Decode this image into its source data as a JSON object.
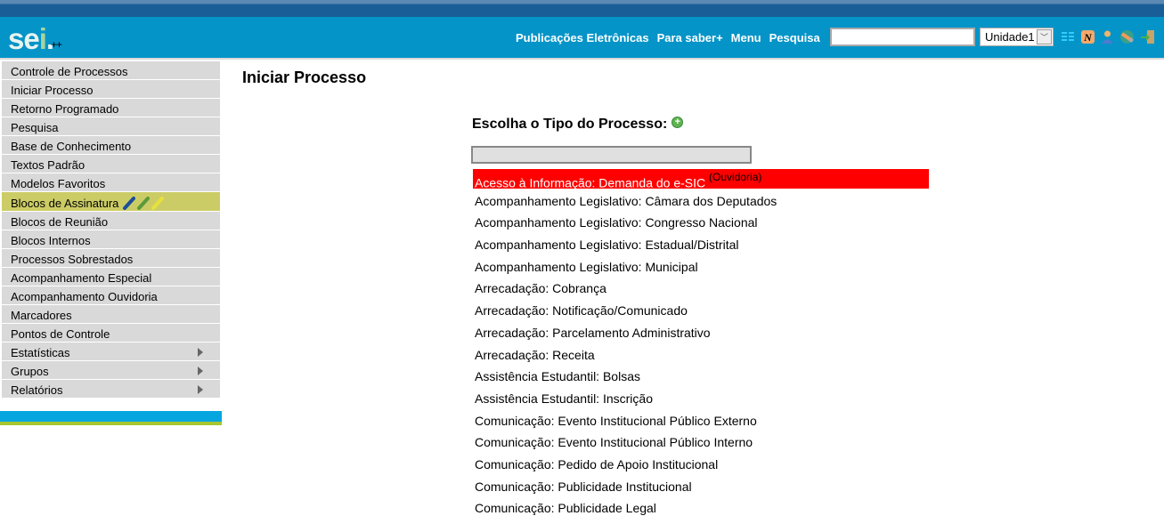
{
  "header": {
    "logo": "sei",
    "logo_suffix": "++",
    "nav": [
      "Publicações Eletrônicas",
      "Para saber+",
      "Menu",
      "Pesquisa"
    ],
    "search_value": "",
    "unit": "Unidade1",
    "icons": [
      "list-icon",
      "notification-icon",
      "user-icon",
      "tools-icon",
      "exit-icon"
    ]
  },
  "sidebar": {
    "items": [
      {
        "label": "Controle de Processos"
      },
      {
        "label": "Iniciar Processo"
      },
      {
        "label": "Retorno Programado"
      },
      {
        "label": "Pesquisa"
      },
      {
        "label": "Base de Conhecimento"
      },
      {
        "label": "Textos Padrão"
      },
      {
        "label": "Modelos Favoritos"
      },
      {
        "label": "Blocos de Assinatura",
        "highlight": true
      },
      {
        "label": "Blocos de Reunião"
      },
      {
        "label": "Blocos Internos"
      },
      {
        "label": "Processos Sobrestados"
      },
      {
        "label": "Acompanhamento Especial"
      },
      {
        "label": "Acompanhamento Ouvidoria"
      },
      {
        "label": "Marcadores"
      },
      {
        "label": "Pontos de Controle"
      },
      {
        "label": "Estatísticas",
        "submenu": true
      },
      {
        "label": "Grupos",
        "submenu": true
      },
      {
        "label": "Relatórios",
        "submenu": true
      }
    ]
  },
  "main": {
    "title": "Iniciar Processo",
    "choose_label": "Escolha o Tipo do Processo:",
    "filter_value": "",
    "types": [
      {
        "label": "Acesso à Informação: Demanda do e-SIC",
        "tag": "(Ouvidoria)",
        "selected": true
      },
      {
        "label": "Acompanhamento Legislativo: Câmara dos Deputados"
      },
      {
        "label": "Acompanhamento Legislativo: Congresso Nacional"
      },
      {
        "label": "Acompanhamento Legislativo: Estadual/Distrital"
      },
      {
        "label": "Acompanhamento Legislativo: Municipal"
      },
      {
        "label": "Arrecadação: Cobrança"
      },
      {
        "label": "Arrecadação: Notificação/Comunicado"
      },
      {
        "label": "Arrecadação: Parcelamento Administrativo"
      },
      {
        "label": "Arrecadação: Receita"
      },
      {
        "label": "Assistência Estudantil: Bolsas"
      },
      {
        "label": "Assistência Estudantil: Inscrição"
      },
      {
        "label": "Comunicação: Evento Institucional Público Externo"
      },
      {
        "label": "Comunicação: Evento Institucional Público Interno"
      },
      {
        "label": "Comunicação: Pedido de Apoio Institucional"
      },
      {
        "label": "Comunicação: Publicidade Institucional"
      },
      {
        "label": "Comunicação: Publicidade Legal"
      }
    ]
  }
}
